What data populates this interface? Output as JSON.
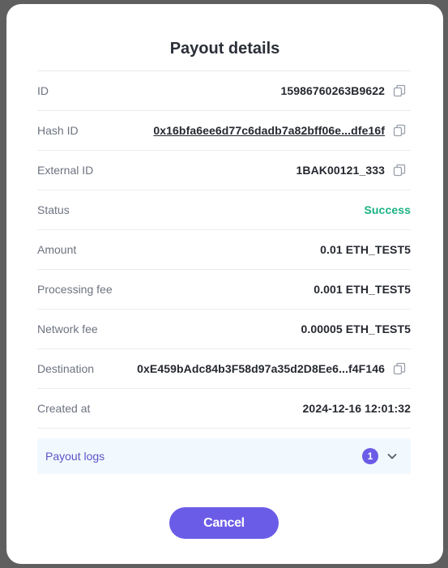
{
  "modal": {
    "title": "Payout details",
    "rows": [
      {
        "label": "ID",
        "value": "15986760263B9622",
        "copyable": true
      },
      {
        "label": "Hash ID",
        "value": "0x16bfa6ee6d77c6dadb7a82bff06e...dfe16f",
        "copyable": true,
        "link": true
      },
      {
        "label": "External ID",
        "value": "1BAK00121_333",
        "copyable": true
      },
      {
        "label": "Status",
        "value": "Success",
        "status_color": "#1bb283"
      },
      {
        "label": "Amount",
        "value": "0.01 ETH_TEST5"
      },
      {
        "label": "Processing fee",
        "value": "0.001 ETH_TEST5"
      },
      {
        "label": "Network fee",
        "value": "0.00005 ETH_TEST5"
      },
      {
        "label": "Destination",
        "value": "0xE459bAdc84b3F58d97a35d2D8Ee6...f4F146",
        "copyable": true
      },
      {
        "label": "Created at",
        "value": "2024-12-16 12:01:32"
      }
    ],
    "logs": {
      "label": "Payout logs",
      "count": "1"
    },
    "cancel_label": "Cancel"
  },
  "colors": {
    "accent": "#6b5ce7",
    "success": "#1bb283",
    "logs_bg": "#f2f9fe"
  },
  "icons": {
    "copy": "copy-icon",
    "chevron": "chevron-down-icon"
  }
}
